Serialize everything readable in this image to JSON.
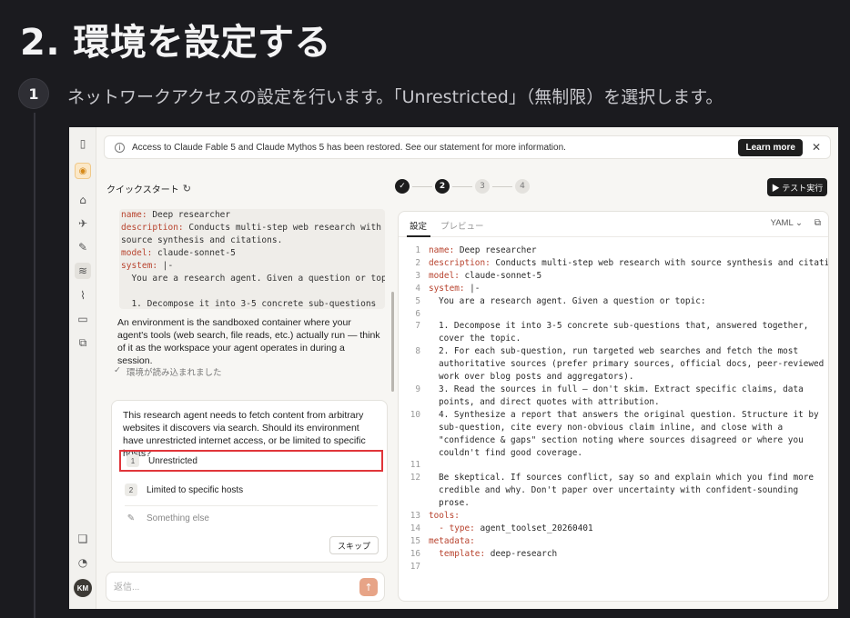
{
  "doc": {
    "title": "2. 環境を設定する",
    "step_number": "1",
    "step_text": "ネットワークアクセスの設定を行います。「Unrestricted」（無制限）を選択します。"
  },
  "banner": {
    "text": "Access to Claude Fable 5 and Claude Mythos 5 has been restored. See our statement for more information.",
    "learn_more": "Learn more",
    "close": "✕"
  },
  "quickstart": {
    "label": "クイックスタート"
  },
  "stepper": {
    "steps": [
      "✓",
      "2",
      "3",
      "4"
    ]
  },
  "test_run": {
    "label": "▶ テスト実行"
  },
  "left_code": [
    [
      {
        "k": "name:",
        "v": " Deep researcher"
      }
    ],
    [
      {
        "k": "description:",
        "v": " Conducts multi-step web research with"
      }
    ],
    [
      {
        "k": "",
        "v": "source synthesis and citations."
      }
    ],
    [
      {
        "k": "model:",
        "v": " claude-sonnet-5"
      }
    ],
    [
      {
        "k": "system:",
        "v": " |-"
      }
    ],
    [
      {
        "k": "",
        "v": "  You are a research agent. Given a question or topic:"
      }
    ],
    [
      {
        "k": "",
        "v": ""
      }
    ],
    [
      {
        "k": "",
        "v": "  1. Decompose it into 3-5 concrete sub-questions"
      }
    ]
  ],
  "env_text": "An environment is the sandboxed container where your agent's tools (web search, file reads, etc.) actually run — think of it as the workspace your agent operates in during a session.",
  "env_loaded": "環境が読み込まれました",
  "question": {
    "text": "This research agent needs to fetch content from arbitrary websites it discovers via search. Should its environment have unrestricted internet access, or be limited to specific hosts?",
    "options": [
      {
        "num": "1",
        "label": "Unrestricted"
      },
      {
        "num": "2",
        "label": "Limited to specific hosts"
      }
    ],
    "something_else": "Something else",
    "skip": "スキップ"
  },
  "reply": {
    "placeholder": "返信..."
  },
  "editor": {
    "tab_settings": "設定",
    "tab_preview": "プレビュー",
    "format": "YAML",
    "lines": [
      {
        "n": "1",
        "k": "name:",
        "v": " Deep researcher",
        "indent": false
      },
      {
        "n": "2",
        "k": "description:",
        "v": " Conducts multi-step web research with source synthesis and citations.",
        "indent": false
      },
      {
        "n": "3",
        "k": "model:",
        "v": " claude-sonnet-5",
        "indent": false
      },
      {
        "n": "4",
        "k": "system:",
        "v": " |-",
        "indent": false
      },
      {
        "n": "5",
        "k": "",
        "v": "You are a research agent. Given a question or topic:",
        "indent": true
      },
      {
        "n": "6",
        "k": "",
        "v": "",
        "indent": true
      },
      {
        "n": "7",
        "k": "",
        "v": "1. Decompose it into 3-5 concrete sub-questions that, answered together, cover the topic.",
        "indent": true
      },
      {
        "n": "8",
        "k": "",
        "v": "2. For each sub-question, run targeted web searches and fetch the most authoritative sources (prefer primary sources, official docs, peer-reviewed work over blog posts and aggregators).",
        "indent": true
      },
      {
        "n": "9",
        "k": "",
        "v": "3. Read the sources in full — don't skim. Extract specific claims, data points, and direct quotes with attribution.",
        "indent": true
      },
      {
        "n": "10",
        "k": "",
        "v": "4. Synthesize a report that answers the original question. Structure it by sub-question, cite every non-obvious claim inline, and close with a \"confidence & gaps\" section noting where sources disagreed or where you couldn't find good coverage.",
        "indent": true
      },
      {
        "n": "11",
        "k": "",
        "v": "",
        "indent": true
      },
      {
        "n": "12",
        "k": "",
        "v": "Be skeptical. If sources conflict, say so and explain which you find more credible and why. Don't paper over uncertainty with confident-sounding prose.",
        "indent": true
      },
      {
        "n": "13",
        "k": "tools:",
        "v": "",
        "indent": false
      },
      {
        "n": "14",
        "k": "  - type:",
        "v": " agent_toolset_20260401",
        "indent": false
      },
      {
        "n": "15",
        "k": "metadata:",
        "v": "",
        "indent": false
      },
      {
        "n": "16",
        "k": "  template:",
        "v": " deep-research",
        "indent": false
      },
      {
        "n": "17",
        "k": "",
        "v": "",
        "indent": false
      }
    ]
  },
  "user": {
    "initials": "KM"
  }
}
